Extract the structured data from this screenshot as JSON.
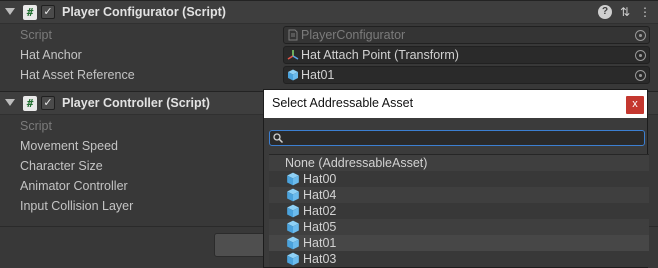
{
  "components": [
    {
      "title": "Player Configurator (Script)",
      "header_icons": [
        "help-icon",
        "preset-icon",
        "menu-icon"
      ],
      "rows": [
        {
          "label": "Script",
          "value": "PlayerConfigurator",
          "disabled": true,
          "icon": "script-file-icon"
        },
        {
          "label": "Hat Anchor",
          "value": "Hat Attach Point (Transform)",
          "disabled": false,
          "icon": "transform-icon"
        },
        {
          "label": "Hat Asset Reference",
          "value": "Hat01",
          "disabled": false,
          "icon": "prefab-cube-icon"
        }
      ]
    },
    {
      "title": "Player Controller (Script)",
      "rows": [
        {
          "label": "Script",
          "disabled": true
        },
        {
          "label": "Movement Speed",
          "disabled": false
        },
        {
          "label": "Character Size",
          "disabled": false
        },
        {
          "label": "Animator Controller",
          "disabled": false
        },
        {
          "label": "Input Collision Layer",
          "disabled": false
        }
      ]
    }
  ],
  "popup": {
    "title": "Select Addressable Asset",
    "close_label": "x",
    "search_value": "",
    "items": [
      {
        "label": "None (AddressableAsset)",
        "icon": null
      },
      {
        "label": "Hat00",
        "icon": "prefab-cube-icon"
      },
      {
        "label": "Hat04",
        "icon": "prefab-cube-icon"
      },
      {
        "label": "Hat02",
        "icon": "prefab-cube-icon"
      },
      {
        "label": "Hat05",
        "icon": "prefab-cube-icon"
      },
      {
        "label": "Hat01",
        "icon": "prefab-cube-icon",
        "selected": true
      },
      {
        "label": "Hat03",
        "icon": "prefab-cube-icon"
      }
    ]
  },
  "colors": {
    "accent_focus": "#3c7fd1",
    "close_button": "#c4372f",
    "prefab_icon": "#5fb4ea"
  }
}
